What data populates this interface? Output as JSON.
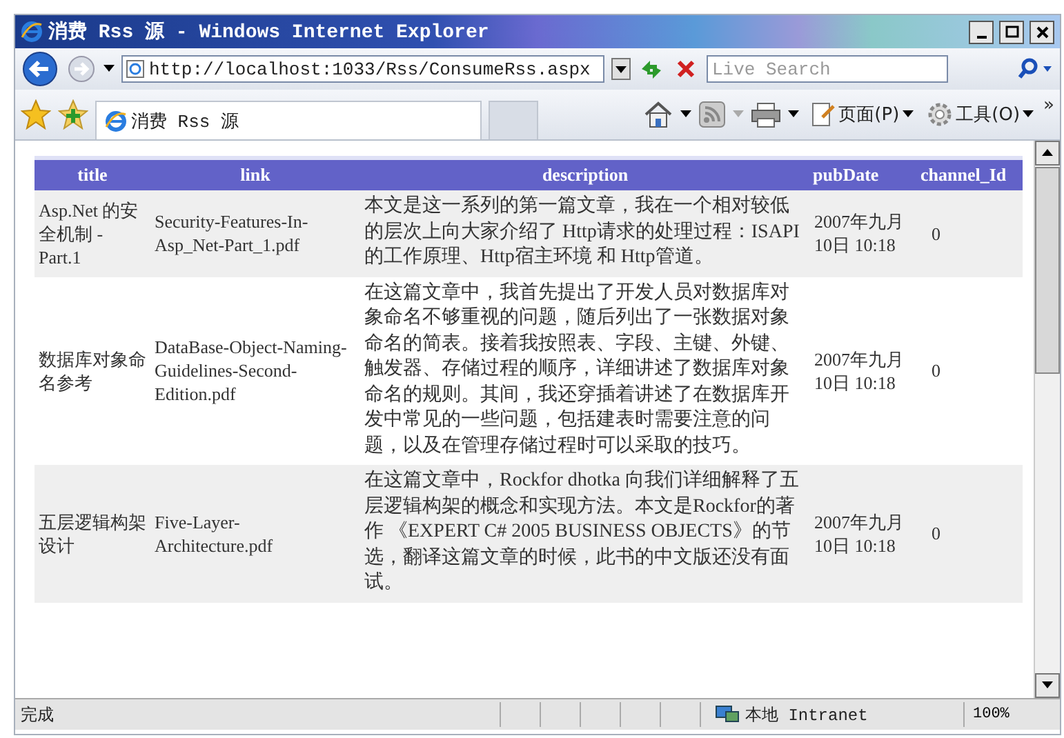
{
  "window": {
    "title": "消费 Rss 源 - Windows Internet Explorer"
  },
  "address_bar": {
    "url": "http://localhost:1033/Rss/ConsumeRss.aspx"
  },
  "search": {
    "placeholder": "Live Search"
  },
  "tabs": [
    {
      "label": "消费 Rss 源",
      "selected": true
    }
  ],
  "toolbar": {
    "items": [
      {
        "label": "页面(P)"
      },
      {
        "label": "工具(O)"
      }
    ],
    "overflow": "»"
  },
  "table": {
    "columns": [
      "title",
      "link",
      "description",
      "pubDate",
      "channel_Id"
    ],
    "rows": [
      [
        "Asp.Net 的安全机制 - Part.1",
        "Security-Features-In-Asp_Net-Part_1.pdf",
        "本文是这一系列的第一篇文章，我在一个相对较低的层次上向大家介绍了 Http请求的处理过程：ISAPI的工作原理、Http宿主环境 和 Http管道。",
        "2007年九月10日 10:18",
        "0"
      ],
      [
        "数据库对象命名参考",
        "DataBase-Object-Naming-Guidelines-Second-Edition.pdf",
        "在这篇文章中，我首先提出了开发人员对数据库对象命名不够重视的问题，随后列出了一张数据对象命名的简表。接着我按照表、字段、主键、外键、触发器、存储过程的顺序，详细讲述了数据库对象命名的规则。其间，我还穿插着讲述了在数据库开发中常见的一些问题，包括建表时需要注意的问题，以及在管理存储过程时可以采取的技巧。",
        "2007年九月10日 10:18",
        "0"
      ],
      [
        "五层逻辑构架设计",
        "Five-Layer-Architecture.pdf",
        "在这篇文章中，Rockfor dhotka 向我们详细解释了五层逻辑构架的概念和实现方法。本文是Rockfor的著作 《EXPERT C# 2005 BUSINESS OBJECTS》的节选，翻译这篇文章的时候，此书的中文版还没有面试。",
        "2007年九月10日 10:18",
        "0"
      ]
    ]
  },
  "status_bar": {
    "text": "完成",
    "zone": "本地 Intranet",
    "zoom": "100%"
  }
}
